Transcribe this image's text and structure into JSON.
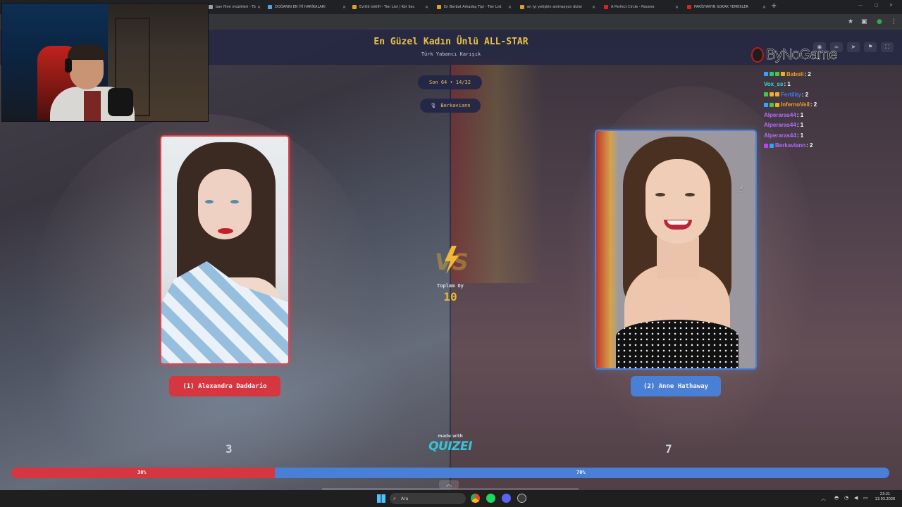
{
  "browser": {
    "tabs": [
      {
        "title": "ban filmi müzikleri - Tü",
        "fav": "#a0a0a0"
      },
      {
        "title": "DOĞANIN EN İYİ HARİKALARI",
        "fav": "#5aa0e0"
      },
      {
        "title": "Evlilik teklifi - Tier List | Kör Sec",
        "fav": "#e0a020"
      },
      {
        "title": "En Berbat Arkadaş Tipi - Tier List",
        "fav": "#e0a020"
      },
      {
        "title": "en iyi yetişkin animasyon dizisi",
        "fav": "#e0a020"
      },
      {
        "title": "A Perfect Circle - Passive",
        "fav": "#e02020"
      },
      {
        "title": "PAKİSTAN'IN SOKAK YEMEKLER",
        "fav": "#e02020"
      }
    ],
    "new_tab": "+"
  },
  "quiz": {
    "title": "En Güzel Kadın Ünlü ALL-STAR",
    "subtitle": "Türk Yabancı Karışık",
    "round": "Son 64 • 14/32",
    "player": "Berkaviann",
    "total_label": "Toplam Oy",
    "total_votes": "10",
    "vs_text": "VS",
    "made_with": "made with",
    "brand": "QUIZEI",
    "left": {
      "name": "(1) Alexandra Daddario",
      "votes": "3",
      "percent_label": "30%",
      "percent": 30,
      "color": "#d6363f"
    },
    "right": {
      "name": "(2) Anne Hathaway",
      "votes": "7",
      "percent_label": "70%",
      "percent": 70,
      "color": "#4a7fd6"
    }
  },
  "overlay": {
    "logo": "ByNoGame",
    "chat": [
      {
        "user": "Baboli",
        "count": ": 2",
        "color": "#f0a030",
        "badges": [
          "#3aa0ff",
          "#35c46a",
          "#46c846",
          "#f0b020"
        ]
      },
      {
        "user": "Vox_ss",
        "count": ": 1",
        "color": "#2fe0d0",
        "badges": []
      },
      {
        "user": "Fertility",
        "count": ": 2",
        "color": "#3a7cff",
        "badges": [
          "#46c846",
          "#f0b020",
          "#f0b020"
        ]
      },
      {
        "user": "InfernoVeil",
        "count": ": 2",
        "color": "#f0a030",
        "badges": [
          "#3aa0ff",
          "#46c846",
          "#f0b020"
        ]
      },
      {
        "user": "Alperaras44",
        "count": ": 1",
        "color": "#b36cff",
        "badges": []
      },
      {
        "user": "Alperaras44",
        "count": ": 1",
        "color": "#b36cff",
        "badges": []
      },
      {
        "user": "Alperaras44",
        "count": ": 1",
        "color": "#b36cff",
        "badges": []
      },
      {
        "user": "Berkaviann",
        "count": ": 2",
        "color": "#b36cff",
        "badges": [
          "#c040f0",
          "#2fa0ff"
        ]
      }
    ]
  },
  "taskbar": {
    "search_placeholder": "Ara",
    "time": "23:21",
    "date": "13.03.2026"
  }
}
